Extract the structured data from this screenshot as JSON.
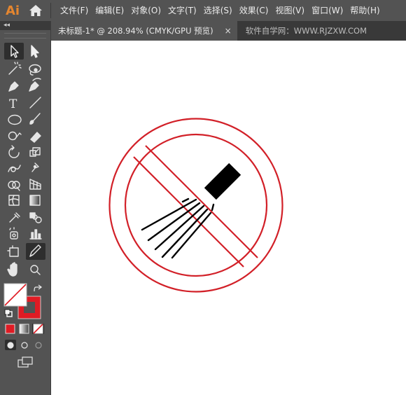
{
  "app": {
    "logo": "Ai"
  },
  "menu": [
    "文件(F)",
    "编辑(E)",
    "对象(O)",
    "文字(T)",
    "选择(S)",
    "效果(C)",
    "视图(V)",
    "窗口(W)",
    "帮助(H)"
  ],
  "toolbar": {
    "collapse_label": "◂◂"
  },
  "tabs": {
    "document": {
      "label": "未标题-1* @ 208.94% (CMYK/GPU 预览)",
      "close": "×"
    },
    "watermark": "软件自学网：WWW.RJZXW.COM"
  },
  "tools": [
    [
      "selection-tool",
      "direct-selection-tool"
    ],
    [
      "magic-wand-tool",
      "lasso-tool"
    ],
    [
      "pen-tool",
      "curvature-tool"
    ],
    [
      "type-tool",
      "line-segment-tool"
    ],
    [
      "ellipse-tool",
      "paintbrush-tool"
    ],
    [
      "shaper-tool",
      "eraser-tool"
    ],
    [
      "rotate-tool",
      "scale-tool"
    ],
    [
      "warp-tool",
      "puppet-warp-tool"
    ],
    [
      "shape-builder-tool",
      "perspective-grid-tool"
    ],
    [
      "mesh-tool",
      "gradient-tool"
    ],
    [
      "eyedropper-tool",
      "blend-tool"
    ],
    [
      "symbol-sprayer-tool",
      "column-graph-tool"
    ],
    [
      "artboard-tool",
      "pencil-tool"
    ],
    [
      "hand-tool",
      "zoom-tool"
    ]
  ],
  "colors": {
    "fill": "none",
    "stroke": "#d9222a",
    "sign_red": "#d22028",
    "accent_logo": "#e5862f"
  },
  "artwork": {
    "description_icon": "no-spraying-sign-icon"
  }
}
